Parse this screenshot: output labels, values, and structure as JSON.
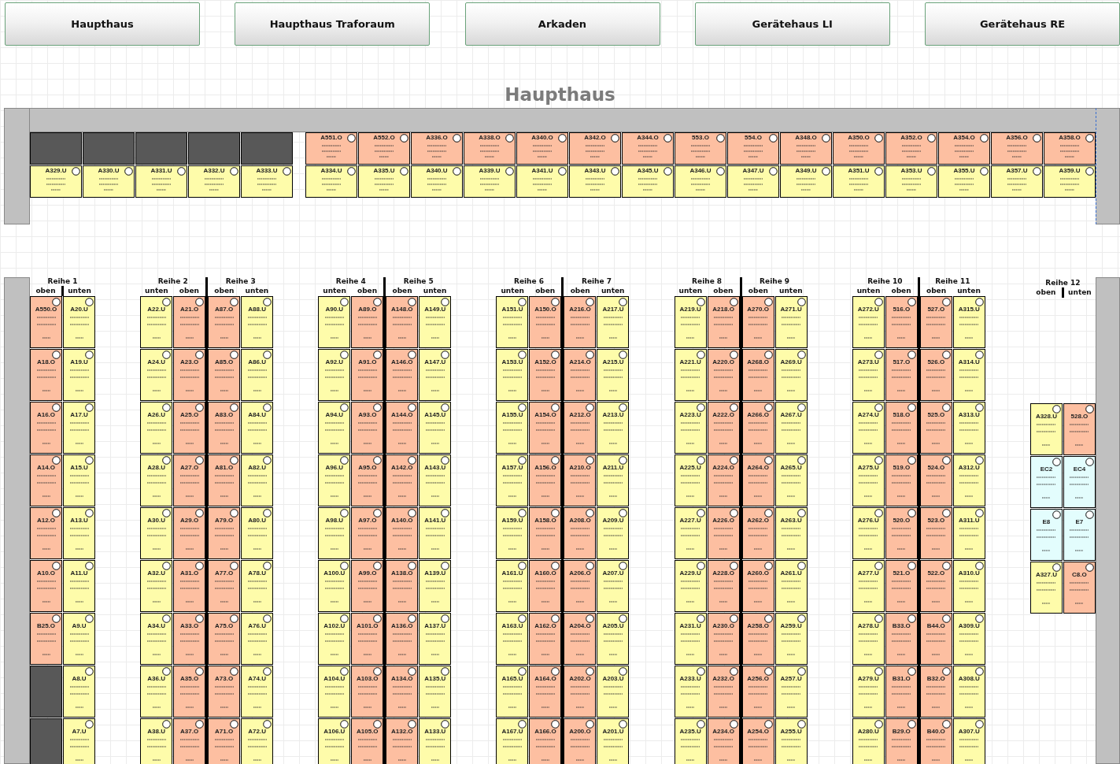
{
  "nav_buttons": [
    {
      "label": "Haupthaus"
    },
    {
      "label": "Haupthaus Traforaum"
    },
    {
      "label": "Arkaden"
    },
    {
      "label": "Gerätehaus LI"
    },
    {
      "label": "Gerätehaus RE"
    }
  ],
  "title": "Haupthaus",
  "top_sections": [
    {
      "rows": [
        [
          {
            "kind": "blocked"
          },
          {
            "kind": "blocked"
          },
          {
            "kind": "blocked"
          },
          {
            "kind": "blocked"
          },
          {
            "kind": "blocked"
          }
        ],
        [
          {
            "label": "A329.U",
            "kind": "unten"
          },
          {
            "label": "A330.U",
            "kind": "unten"
          },
          {
            "label": "A331.U",
            "kind": "unten"
          },
          {
            "label": "A332.U",
            "kind": "unten"
          },
          {
            "label": "A333.U",
            "kind": "unten"
          }
        ]
      ]
    },
    {
      "rows": [
        [
          {
            "label": "A551.O",
            "kind": "oben"
          },
          {
            "label": "A552.O",
            "kind": "oben"
          },
          {
            "label": "A336.O",
            "kind": "oben"
          },
          {
            "label": "A338.O",
            "kind": "oben"
          },
          {
            "label": "A340.O",
            "kind": "oben"
          },
          {
            "label": "A342.O",
            "kind": "oben"
          },
          {
            "label": "A344.O",
            "kind": "oben"
          },
          {
            "label": "553.O",
            "kind": "oben"
          },
          {
            "label": "554.O",
            "kind": "oben"
          },
          {
            "label": "A348.O",
            "kind": "oben"
          },
          {
            "label": "A350.O",
            "kind": "oben"
          },
          {
            "label": "A352.O",
            "kind": "oben"
          },
          {
            "label": "A354.O",
            "kind": "oben"
          },
          {
            "label": "A356.O",
            "kind": "oben"
          },
          {
            "label": "A358.O",
            "kind": "oben"
          }
        ],
        [
          {
            "label": "A334.U",
            "kind": "unten"
          },
          {
            "label": "A335.U",
            "kind": "unten"
          },
          {
            "label": "A340.U",
            "kind": "unten"
          },
          {
            "label": "A339.U",
            "kind": "unten"
          },
          {
            "label": "A341.U",
            "kind": "unten"
          },
          {
            "label": "A343.U",
            "kind": "unten"
          },
          {
            "label": "A345.U",
            "kind": "unten"
          },
          {
            "label": "A346.U",
            "kind": "unten"
          },
          {
            "label": "A347.U",
            "kind": "unten"
          },
          {
            "label": "A349.U",
            "kind": "unten"
          },
          {
            "label": "A351.U",
            "kind": "unten"
          },
          {
            "label": "A353.U",
            "kind": "unten"
          },
          {
            "label": "A355.U",
            "kind": "unten"
          },
          {
            "label": "A357.U",
            "kind": "unten"
          },
          {
            "label": "A359.U",
            "kind": "unten"
          }
        ]
      ]
    }
  ],
  "reihe_groups": [
    {
      "reihen": [
        {
          "title": "Reihe 1",
          "sides": [
            "oben",
            "unten"
          ],
          "columns": [
            [
              {
                "label": "A550.O",
                "kind": "oben"
              },
              {
                "label": "A18.O",
                "kind": "oben"
              },
              {
                "label": "A16.O",
                "kind": "oben"
              },
              {
                "label": "A14.O",
                "kind": "oben"
              },
              {
                "label": "A12.O",
                "kind": "oben"
              },
              {
                "label": "A10.O",
                "kind": "oben"
              },
              {
                "label": "B25.O",
                "kind": "oben"
              },
              {
                "kind": "blocked"
              },
              {
                "kind": "blocked"
              }
            ],
            [
              {
                "label": "A20.U",
                "kind": "unten"
              },
              {
                "label": "A19.U",
                "kind": "unten"
              },
              {
                "label": "A17.U",
                "kind": "unten"
              },
              {
                "label": "A15.U",
                "kind": "unten"
              },
              {
                "label": "A13.U",
                "kind": "unten"
              },
              {
                "label": "A11.U",
                "kind": "unten"
              },
              {
                "label": "A9.U",
                "kind": "unten"
              },
              {
                "label": "A8.U",
                "kind": "unten"
              },
              {
                "label": "A7.U",
                "kind": "unten"
              }
            ]
          ]
        }
      ]
    },
    {
      "reihen": [
        {
          "title": "Reihe 2",
          "sides": [
            "unten",
            "oben"
          ],
          "columns": [
            [
              {
                "label": "A22.U",
                "kind": "unten"
              },
              {
                "label": "A24.U",
                "kind": "unten"
              },
              {
                "label": "A26.U",
                "kind": "unten"
              },
              {
                "label": "A28.U",
                "kind": "unten"
              },
              {
                "label": "A30.U",
                "kind": "unten"
              },
              {
                "label": "A32.U",
                "kind": "unten"
              },
              {
                "label": "A34.U",
                "kind": "unten"
              },
              {
                "label": "A36.U",
                "kind": "unten"
              },
              {
                "label": "A38.U",
                "kind": "unten"
              }
            ],
            [
              {
                "label": "A21.O",
                "kind": "oben"
              },
              {
                "label": "A23.O",
                "kind": "oben"
              },
              {
                "label": "A25.O",
                "kind": "oben"
              },
              {
                "label": "A27.O",
                "kind": "oben"
              },
              {
                "label": "A29.O",
                "kind": "oben"
              },
              {
                "label": "A31.O",
                "kind": "oben"
              },
              {
                "label": "A33.O",
                "kind": "oben"
              },
              {
                "label": "A35.O",
                "kind": "oben"
              },
              {
                "label": "A37.O",
                "kind": "oben"
              }
            ]
          ]
        },
        {
          "title": "Reihe 3",
          "sides": [
            "oben",
            "unten"
          ],
          "columns": [
            [
              {
                "label": "A87.O",
                "kind": "oben"
              },
              {
                "label": "A85.O",
                "kind": "oben"
              },
              {
                "label": "A83.O",
                "kind": "oben"
              },
              {
                "label": "A81.O",
                "kind": "oben"
              },
              {
                "label": "A79.O",
                "kind": "oben"
              },
              {
                "label": "A77.O",
                "kind": "oben"
              },
              {
                "label": "A75.O",
                "kind": "oben"
              },
              {
                "label": "A73.O",
                "kind": "oben"
              },
              {
                "label": "A71.O",
                "kind": "oben"
              }
            ],
            [
              {
                "label": "A88.U",
                "kind": "unten"
              },
              {
                "label": "A86.U",
                "kind": "unten"
              },
              {
                "label": "A84.U",
                "kind": "unten"
              },
              {
                "label": "A82.U",
                "kind": "unten"
              },
              {
                "label": "A80.U",
                "kind": "unten"
              },
              {
                "label": "A78.U",
                "kind": "unten"
              },
              {
                "label": "A76.U",
                "kind": "unten"
              },
              {
                "label": "A74.U",
                "kind": "unten"
              },
              {
                "label": "A72.U",
                "kind": "unten"
              }
            ]
          ]
        }
      ]
    },
    {
      "reihen": [
        {
          "title": "Reihe 4",
          "sides": [
            "unten",
            "oben"
          ],
          "columns": [
            [
              {
                "label": "A90.U",
                "kind": "unten"
              },
              {
                "label": "A92.U",
                "kind": "unten"
              },
              {
                "label": "A94.U",
                "kind": "unten"
              },
              {
                "label": "A96.U",
                "kind": "unten"
              },
              {
                "label": "A98.U",
                "kind": "unten"
              },
              {
                "label": "A100.U",
                "kind": "unten"
              },
              {
                "label": "A102.U",
                "kind": "unten"
              },
              {
                "label": "A104.U",
                "kind": "unten"
              },
              {
                "label": "A106.U",
                "kind": "unten"
              }
            ],
            [
              {
                "label": "A89.O",
                "kind": "oben"
              },
              {
                "label": "A91.O",
                "kind": "oben"
              },
              {
                "label": "A93.O",
                "kind": "oben"
              },
              {
                "label": "A95.O",
                "kind": "oben"
              },
              {
                "label": "A97.O",
                "kind": "oben"
              },
              {
                "label": "A99.O",
                "kind": "oben"
              },
              {
                "label": "A101.O",
                "kind": "oben"
              },
              {
                "label": "A103.O",
                "kind": "oben"
              },
              {
                "label": "A105.O",
                "kind": "oben"
              }
            ]
          ]
        },
        {
          "title": "Reihe 5",
          "sides": [
            "oben",
            "unten"
          ],
          "columns": [
            [
              {
                "label": "A148.O",
                "kind": "oben"
              },
              {
                "label": "A146.O",
                "kind": "oben"
              },
              {
                "label": "A144.O",
                "kind": "oben"
              },
              {
                "label": "A142.O",
                "kind": "oben"
              },
              {
                "label": "A140.O",
                "kind": "oben"
              },
              {
                "label": "A138.O",
                "kind": "oben"
              },
              {
                "label": "A136.O",
                "kind": "oben"
              },
              {
                "label": "A134.O",
                "kind": "oben"
              },
              {
                "label": "A132.O",
                "kind": "oben"
              }
            ],
            [
              {
                "label": "A149.U",
                "kind": "unten"
              },
              {
                "label": "A147.U",
                "kind": "unten"
              },
              {
                "label": "A145.U",
                "kind": "unten"
              },
              {
                "label": "A143.U",
                "kind": "unten"
              },
              {
                "label": "A141.U",
                "kind": "unten"
              },
              {
                "label": "A139.U",
                "kind": "unten"
              },
              {
                "label": "A137.U",
                "kind": "unten"
              },
              {
                "label": "A135.U",
                "kind": "unten"
              },
              {
                "label": "A133.U",
                "kind": "unten"
              }
            ]
          ]
        }
      ]
    },
    {
      "reihen": [
        {
          "title": "Reihe 6",
          "sides": [
            "unten",
            "oben"
          ],
          "columns": [
            [
              {
                "label": "A151.U",
                "kind": "unten"
              },
              {
                "label": "A153.U",
                "kind": "unten"
              },
              {
                "label": "A155.U",
                "kind": "unten"
              },
              {
                "label": "A157.U",
                "kind": "unten"
              },
              {
                "label": "A159.U",
                "kind": "unten"
              },
              {
                "label": "A161.U",
                "kind": "unten"
              },
              {
                "label": "A163.U",
                "kind": "unten"
              },
              {
                "label": "A165.U",
                "kind": "unten"
              },
              {
                "label": "A167.U",
                "kind": "unten"
              }
            ],
            [
              {
                "label": "A150.O",
                "kind": "oben"
              },
              {
                "label": "A152.O",
                "kind": "oben"
              },
              {
                "label": "A154.O",
                "kind": "oben"
              },
              {
                "label": "A156.O",
                "kind": "oben"
              },
              {
                "label": "A158.O",
                "kind": "oben"
              },
              {
                "label": "A160.O",
                "kind": "oben"
              },
              {
                "label": "A162.O",
                "kind": "oben"
              },
              {
                "label": "A164.O",
                "kind": "oben"
              },
              {
                "label": "A166.O",
                "kind": "oben"
              }
            ]
          ]
        },
        {
          "title": "Reihe 7",
          "sides": [
            "oben",
            "unten"
          ],
          "columns": [
            [
              {
                "label": "A216.O",
                "kind": "oben"
              },
              {
                "label": "A214.O",
                "kind": "oben"
              },
              {
                "label": "A212.O",
                "kind": "oben"
              },
              {
                "label": "A210.O",
                "kind": "oben"
              },
              {
                "label": "A208.O",
                "kind": "oben"
              },
              {
                "label": "A206.O",
                "kind": "oben"
              },
              {
                "label": "A204.O",
                "kind": "oben"
              },
              {
                "label": "A202.O",
                "kind": "oben"
              },
              {
                "label": "A200.O",
                "kind": "oben"
              }
            ],
            [
              {
                "label": "A217.U",
                "kind": "unten"
              },
              {
                "label": "A215.U",
                "kind": "unten"
              },
              {
                "label": "A213.U",
                "kind": "unten"
              },
              {
                "label": "A211.U",
                "kind": "unten"
              },
              {
                "label": "A209.U",
                "kind": "unten"
              },
              {
                "label": "A207.U",
                "kind": "unten"
              },
              {
                "label": "A205.U",
                "kind": "unten"
              },
              {
                "label": "A203.U",
                "kind": "unten"
              },
              {
                "label": "A201.U",
                "kind": "unten"
              }
            ]
          ]
        }
      ]
    },
    {
      "reihen": [
        {
          "title": "Reihe 8",
          "sides": [
            "unten",
            "oben"
          ],
          "columns": [
            [
              {
                "label": "A219.U",
                "kind": "unten"
              },
              {
                "label": "A221.U",
                "kind": "unten"
              },
              {
                "label": "A223.U",
                "kind": "unten"
              },
              {
                "label": "A225.U",
                "kind": "unten"
              },
              {
                "label": "A227.U",
                "kind": "unten"
              },
              {
                "label": "A229.U",
                "kind": "unten"
              },
              {
                "label": "A231.U",
                "kind": "unten"
              },
              {
                "label": "A233.U",
                "kind": "unten"
              },
              {
                "label": "A235.U",
                "kind": "unten"
              }
            ],
            [
              {
                "label": "A218.O",
                "kind": "oben"
              },
              {
                "label": "A220.O",
                "kind": "oben"
              },
              {
                "label": "A222.O",
                "kind": "oben"
              },
              {
                "label": "A224.O",
                "kind": "oben"
              },
              {
                "label": "A226.O",
                "kind": "oben"
              },
              {
                "label": "A228.O",
                "kind": "oben"
              },
              {
                "label": "A230.O",
                "kind": "oben"
              },
              {
                "label": "A232.O",
                "kind": "oben"
              },
              {
                "label": "A234.O",
                "kind": "oben"
              }
            ]
          ]
        },
        {
          "title": "Reihe 9",
          "sides": [
            "oben",
            "unten"
          ],
          "columns": [
            [
              {
                "label": "A270.O",
                "kind": "oben"
              },
              {
                "label": "A268.O",
                "kind": "oben"
              },
              {
                "label": "A266.O",
                "kind": "oben"
              },
              {
                "label": "A264.O",
                "kind": "oben"
              },
              {
                "label": "A262.O",
                "kind": "oben"
              },
              {
                "label": "A260.O",
                "kind": "oben"
              },
              {
                "label": "A258.O",
                "kind": "oben"
              },
              {
                "label": "A256.O",
                "kind": "oben"
              },
              {
                "label": "A254.O",
                "kind": "oben"
              }
            ],
            [
              {
                "label": "A271.U",
                "kind": "unten"
              },
              {
                "label": "A269.U",
                "kind": "unten"
              },
              {
                "label": "A267.U",
                "kind": "unten"
              },
              {
                "label": "A265.U",
                "kind": "unten"
              },
              {
                "label": "A263.U",
                "kind": "unten"
              },
              {
                "label": "A261.U",
                "kind": "unten"
              },
              {
                "label": "A259.U",
                "kind": "unten"
              },
              {
                "label": "A257.U",
                "kind": "unten"
              },
              {
                "label": "A255.U",
                "kind": "unten"
              }
            ]
          ]
        }
      ]
    },
    {
      "reihen": [
        {
          "title": "Reihe 10",
          "sides": [
            "unten",
            "oben"
          ],
          "columns": [
            [
              {
                "label": "A272.U",
                "kind": "unten"
              },
              {
                "label": "A273.U",
                "kind": "unten"
              },
              {
                "label": "A274.U",
                "kind": "unten"
              },
              {
                "label": "A275.U",
                "kind": "unten"
              },
              {
                "label": "A276.U",
                "kind": "unten"
              },
              {
                "label": "A277.U",
                "kind": "unten"
              },
              {
                "label": "A278.U",
                "kind": "unten"
              },
              {
                "label": "A279.U",
                "kind": "unten"
              },
              {
                "label": "A280.U",
                "kind": "unten"
              }
            ],
            [
              {
                "label": "516.O",
                "kind": "oben"
              },
              {
                "label": "517.O",
                "kind": "oben"
              },
              {
                "label": "518.O",
                "kind": "oben"
              },
              {
                "label": "519.O",
                "kind": "oben"
              },
              {
                "label": "520.O",
                "kind": "oben"
              },
              {
                "label": "521.O",
                "kind": "oben"
              },
              {
                "label": "B33.O",
                "kind": "oben"
              },
              {
                "label": "B31.O",
                "kind": "oben"
              },
              {
                "label": "B29.O",
                "kind": "oben"
              }
            ]
          ]
        },
        {
          "title": "Reihe 11",
          "sides": [
            "oben",
            "unten"
          ],
          "columns": [
            [
              {
                "label": "527.O",
                "kind": "oben"
              },
              {
                "label": "526.O",
                "kind": "oben"
              },
              {
                "label": "525.O",
                "kind": "oben"
              },
              {
                "label": "524.O",
                "kind": "oben"
              },
              {
                "label": "523.O",
                "kind": "oben"
              },
              {
                "label": "522.O",
                "kind": "oben"
              },
              {
                "label": "B44.O",
                "kind": "oben"
              },
              {
                "label": "B32.O",
                "kind": "oben"
              },
              {
                "label": "B40.O",
                "kind": "oben"
              }
            ],
            [
              {
                "label": "A315.U",
                "kind": "unten"
              },
              {
                "label": "A314.U",
                "kind": "unten"
              },
              {
                "label": "A313.U",
                "kind": "unten"
              },
              {
                "label": "A312.U",
                "kind": "unten"
              },
              {
                "label": "A311.U",
                "kind": "unten"
              },
              {
                "label": "A310.U",
                "kind": "unten"
              },
              {
                "label": "A309.U",
                "kind": "unten"
              },
              {
                "label": "A308.U",
                "kind": "unten"
              },
              {
                "label": "A307.U",
                "kind": "unten"
              }
            ]
          ]
        }
      ]
    },
    {
      "reihen": [
        {
          "title": "Reihe 12",
          "sides": [
            "oben",
            "unten"
          ],
          "columns": [
            [
              {
                "kind": "empty"
              },
              {
                "kind": "empty"
              },
              {
                "label": "A328.U",
                "kind": "unten"
              },
              {
                "label": "EC2",
                "kind": "special"
              },
              {
                "label": "E8",
                "kind": "special"
              },
              {
                "label": "A327.U",
                "kind": "unten"
              }
            ],
            [
              {
                "kind": "empty"
              },
              {
                "kind": "empty"
              },
              {
                "label": "528.O",
                "kind": "oben"
              },
              {
                "label": "EC4",
                "kind": "special"
              },
              {
                "label": "E7",
                "kind": "special"
              },
              {
                "label": "C8.O",
                "kind": "oben"
              }
            ]
          ]
        }
      ]
    }
  ]
}
